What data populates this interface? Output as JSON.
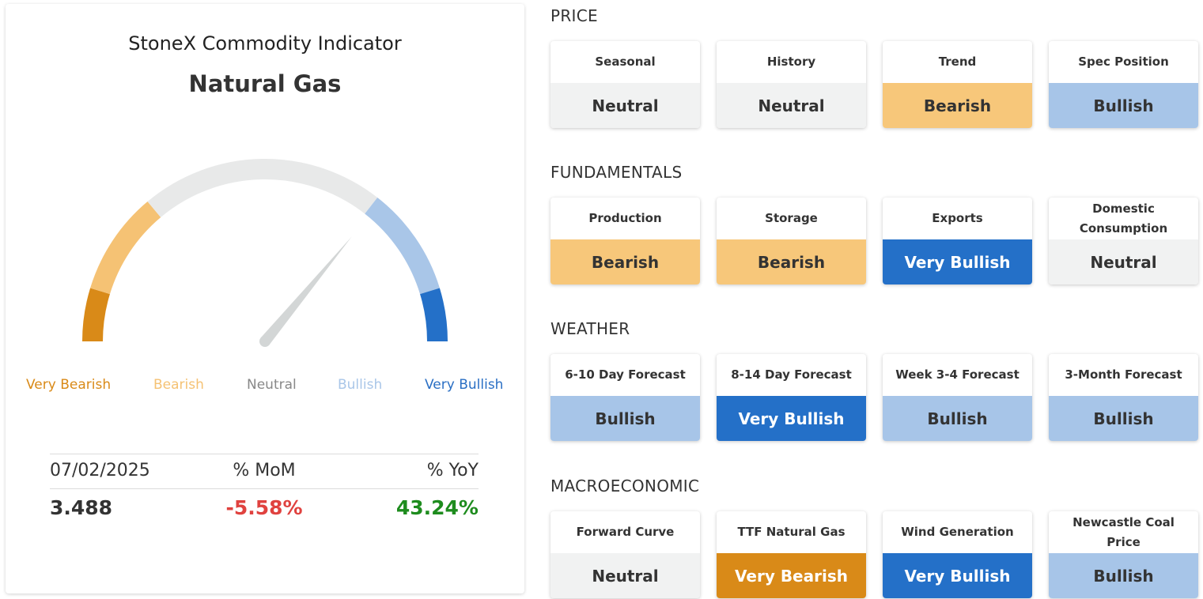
{
  "gauge": {
    "title": "StoneX Commodity Indicator",
    "commodity": "Natural Gas",
    "level_fraction": 0.72,
    "labels": [
      {
        "text": "Very Bearish",
        "color": "#d98a18"
      },
      {
        "text": "Bearish",
        "color": "#f5c274"
      },
      {
        "text": "Neutral",
        "color": "#888888"
      },
      {
        "text": "Bullish",
        "color": "#a9c6e8"
      },
      {
        "text": "Very Bullish",
        "color": "#2a6fc4"
      }
    ]
  },
  "stats": {
    "date": "07/02/2025",
    "mom_label": "% MoM",
    "yoy_label": "% YoY",
    "price": "3.488",
    "mom": "-5.58%",
    "yoy": "43.24%",
    "mom_color": "#e0423f",
    "yoy_color": "#1e8c1e"
  },
  "ratings": {
    "Very Bearish": {
      "bg": "#d98a18",
      "fg": "#ffffff"
    },
    "Bearish": {
      "bg": "#f7c77a",
      "fg": "#333333"
    },
    "Neutral": {
      "bg": "#f1f2f2",
      "fg": "#333333"
    },
    "Bullish": {
      "bg": "#a7c5e8",
      "fg": "#333333"
    },
    "Very Bullish": {
      "bg": "#2470c8",
      "fg": "#ffffff"
    }
  },
  "sections": [
    {
      "title": "PRICE",
      "items": [
        {
          "label": "Seasonal",
          "value": "Neutral"
        },
        {
          "label": "History",
          "value": "Neutral"
        },
        {
          "label": "Trend",
          "value": "Bearish"
        },
        {
          "label": "Spec Position",
          "value": "Bullish"
        }
      ]
    },
    {
      "title": "FUNDAMENTALS",
      "items": [
        {
          "label": "Production",
          "value": "Bearish"
        },
        {
          "label": "Storage",
          "value": "Bearish"
        },
        {
          "label": "Exports",
          "value": "Very Bullish"
        },
        {
          "label": "Domestic Consumption",
          "value": "Neutral"
        }
      ]
    },
    {
      "title": "WEATHER",
      "items": [
        {
          "label": "6-10 Day Forecast",
          "value": "Bullish"
        },
        {
          "label": "8-14 Day Forecast",
          "value": "Very Bullish"
        },
        {
          "label": "Week 3-4 Forecast",
          "value": "Bullish"
        },
        {
          "label": "3-Month Forecast",
          "value": "Bullish"
        }
      ]
    },
    {
      "title": "MACROECONOMIC",
      "items": [
        {
          "label": "Forward Curve",
          "value": "Neutral"
        },
        {
          "label": "TTF Natural Gas",
          "value": "Very Bearish"
        },
        {
          "label": "Wind Generation",
          "value": "Very Bullish"
        },
        {
          "label": "Newcastle Coal Price",
          "value": "Bullish"
        }
      ]
    }
  ]
}
